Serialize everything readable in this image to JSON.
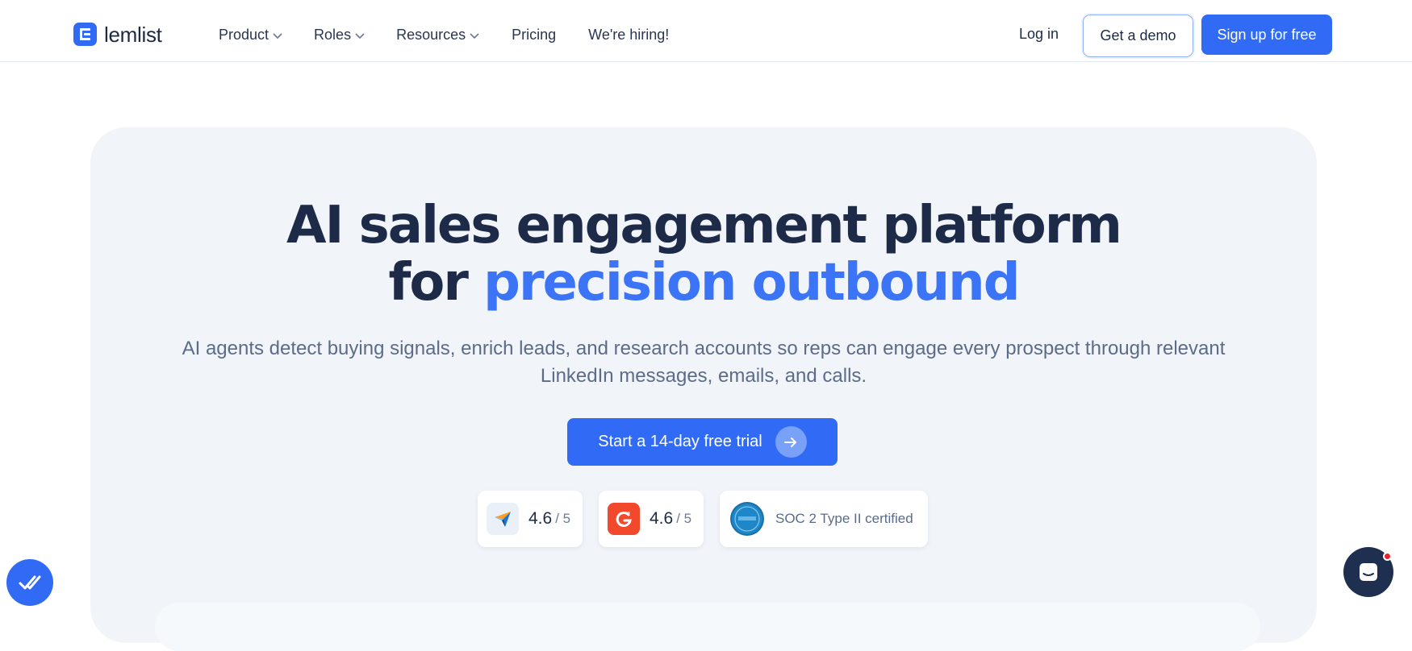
{
  "header": {
    "logo_text": "lemlist",
    "nav": [
      {
        "label": "Product",
        "has_dropdown": true
      },
      {
        "label": "Roles",
        "has_dropdown": true
      },
      {
        "label": "Resources",
        "has_dropdown": true
      },
      {
        "label": "Pricing",
        "has_dropdown": false
      },
      {
        "label": "We're hiring!",
        "has_dropdown": false
      }
    ],
    "login_label": "Log in",
    "demo_label": "Get a demo",
    "signup_label": "Sign up for free"
  },
  "hero": {
    "title_line1": "AI sales engagement platform",
    "title_line2_prefix": "for ",
    "title_line2_accent": "precision outbound",
    "subtitle_line1": "AI agents detect buying signals, enrich leads, and research accounts so reps can engage every prospect through relevant",
    "subtitle_line2": "LinkedIn messages, emails, and calls.",
    "cta_label": "Start a 14-day free trial"
  },
  "badges": [
    {
      "icon": "capterra-icon",
      "score": "4.6",
      "out_of": "/ 5"
    },
    {
      "icon": "g2-icon",
      "score": "4.6",
      "out_of": "/ 5"
    },
    {
      "icon": "aicpa-soc-icon",
      "label": "SOC 2 Type II certified"
    }
  ],
  "colors": {
    "brand_blue": "#316bf5",
    "accent_blue": "#3b74f6",
    "heading": "#1e2b48",
    "hero_bg": "#f1f5fa",
    "g2_red": "#f2482c",
    "chat_dark": "#1e2f4f"
  }
}
